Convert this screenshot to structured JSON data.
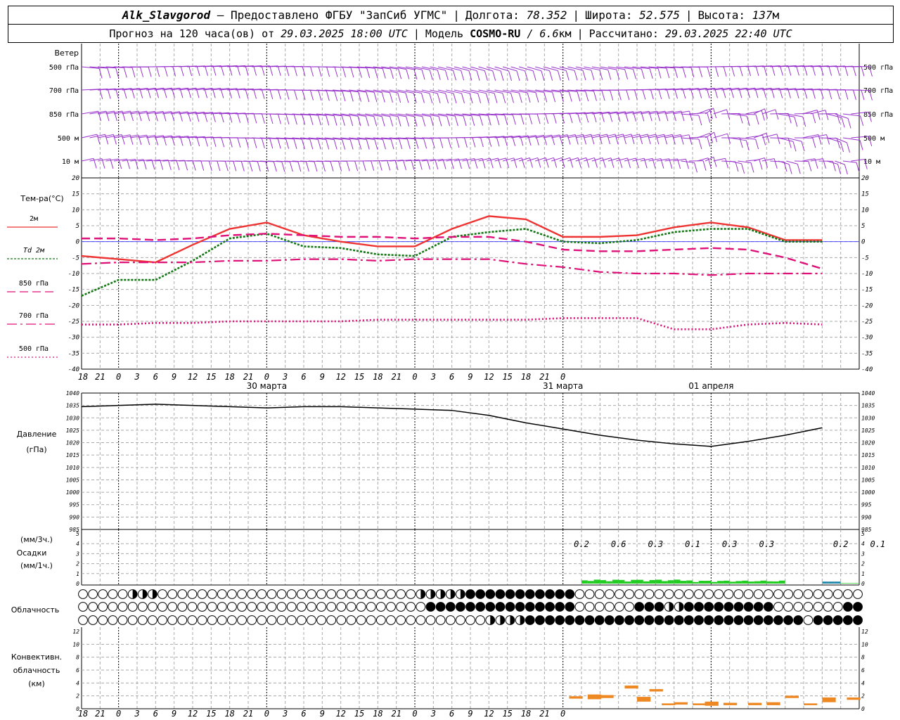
{
  "header": {
    "station": "Alk_Slavgorod",
    "provider": "— Предоставлено ФГБУ \"ЗапСиб УГМС\"",
    "lon_label": "Долгота:",
    "lon": "78.352",
    "lat_label": "Широта:",
    "lat": "52.575",
    "alt_label": "Высота:",
    "alt": "137",
    "alt_unit": "м",
    "forecast_label": "Прогноз на 120 часа(ов)  от",
    "forecast_from": "29.03.2025 18:00 UTC",
    "model_label": "Модель",
    "model": "COSMO-RU",
    "model_res": "/ 6.6",
    "model_res_unit": "км",
    "calc_label": "Рассчитано:",
    "calc_time": "29.03.2025 22:40 UTC"
  },
  "colors": {
    "wind": "#9933cc",
    "t2m": "#ee3333",
    "td": "#117711",
    "t850": "#dd1177",
    "t700": "#dd1177",
    "t500": "#dd1177",
    "pressure": "#000000",
    "precip": "#22cc22",
    "precip_mix": "#2288aa",
    "convective": "#ee8822",
    "grid": "#aaaaaa"
  },
  "chart_data": [
    {
      "type": "wind-barbs",
      "title": "Ветер",
      "levels": [
        "500 гПа",
        "700 гПа",
        "850 гПа",
        "500 м",
        "10  м"
      ]
    },
    {
      "type": "line",
      "title": "Тем-ра(°C)",
      "ylim": [
        -40,
        20
      ],
      "yticks": [
        20,
        15,
        10,
        5,
        0,
        -5,
        -10,
        -15,
        -20,
        -25,
        -30,
        -35,
        -40
      ],
      "x_hours": [
        0,
        6,
        12,
        18,
        24,
        30,
        36,
        42,
        48,
        54,
        60,
        66,
        72,
        78,
        84,
        90,
        96,
        102,
        108,
        114,
        120
      ],
      "series": [
        {
          "name": "2м",
          "label_prefix": "",
          "values": [
            -4.5,
            -5.5,
            -6.5,
            -1,
            4,
            6,
            2,
            0,
            -1.5,
            -1.5,
            4,
            8,
            7,
            1.5,
            1.5,
            2,
            4.5,
            6,
            4.5,
            0.5,
            0.5
          ]
        },
        {
          "name": "2м",
          "label_prefix": "Td",
          "values": [
            -17,
            -12,
            -12,
            -6,
            1,
            2.5,
            -1.5,
            -2,
            -4,
            -4.5,
            1.5,
            3,
            4,
            0,
            -0.5,
            0.5,
            3,
            4,
            4,
            0,
            0
          ]
        },
        {
          "name": "850 гПа",
          "label_prefix": "",
          "values": [
            1,
            1,
            0.5,
            1,
            2,
            2.5,
            2,
            1.5,
            1.5,
            1,
            1.5,
            1.5,
            0,
            -2.5,
            -3,
            -3,
            -2.5,
            -2,
            -2.5,
            -5,
            -8.5
          ]
        },
        {
          "name": "700 гПа",
          "label_prefix": "",
          "values": [
            -7,
            -6.5,
            -6.5,
            -6.5,
            -6,
            -6,
            -5.5,
            -5.5,
            -6,
            -5.5,
            -5.5,
            -5.5,
            -7,
            -8,
            -9.5,
            -10,
            -10,
            -10.5,
            -10,
            -10,
            -10
          ]
        },
        {
          "name": "500 гПа",
          "label_prefix": "",
          "values": [
            -26,
            -26,
            -25.5,
            -25.5,
            -25,
            -25,
            -25,
            -25,
            -24.5,
            -24.5,
            -24.5,
            -24.5,
            -24.5,
            -24,
            -24,
            -24,
            -27.5,
            -27.5,
            -26,
            -25.5,
            -26
          ]
        }
      ]
    },
    {
      "type": "line",
      "title": "Давление",
      "ylabel": "(гПа)",
      "ylim": [
        985,
        1040
      ],
      "yticks": [
        1040,
        1035,
        1030,
        1025,
        1020,
        1015,
        1010,
        1005,
        1000,
        995,
        990,
        985
      ],
      "series": [
        {
          "name": "",
          "values": [
            1034.5,
            1035,
            1035.5,
            1035,
            1034.5,
            1034,
            1034.5,
            1034.5,
            1034,
            1033.5,
            1033,
            1031,
            1028,
            1025.5,
            1023,
            1021,
            1019.5,
            1018.5,
            1020.5,
            1023,
            1026
          ]
        }
      ]
    },
    {
      "type": "bar",
      "title": "Осадки",
      "ylabel_top": "(мм/3ч.)",
      "ylabel_bottom": "(мм/1ч.)",
      "ylim": [
        0,
        5
      ],
      "yticks": [
        5,
        4,
        3,
        2,
        1,
        0
      ],
      "x_hours": [
        81,
        87,
        93,
        99,
        105,
        111,
        123,
        129
      ],
      "values_label": [
        "0.2",
        "0.6",
        "0.3",
        "0.1",
        "0.3",
        "0.3",
        "0.2",
        "0.1"
      ]
    },
    {
      "type": "cloud-rows",
      "title": "Облачность",
      "rows": 3
    },
    {
      "type": "bar",
      "title": "Конвективн. облачность",
      "ylabel": "(км)",
      "ylim": [
        0,
        13
      ],
      "yticks": [
        12,
        10,
        8,
        6,
        4,
        2,
        0
      ]
    }
  ],
  "axis": {
    "hour_labels": [
      "18",
      "21",
      "0",
      "3",
      "6",
      "9",
      "12",
      "15",
      "18",
      "21",
      "0",
      "3",
      "6",
      "9",
      "12",
      "15",
      "18",
      "21",
      "0",
      "3",
      "6",
      "9",
      "12",
      "15",
      "18",
      "21",
      "0"
    ],
    "day_labels": [
      "30 марта",
      "31 марта",
      "01 апреля"
    ]
  }
}
